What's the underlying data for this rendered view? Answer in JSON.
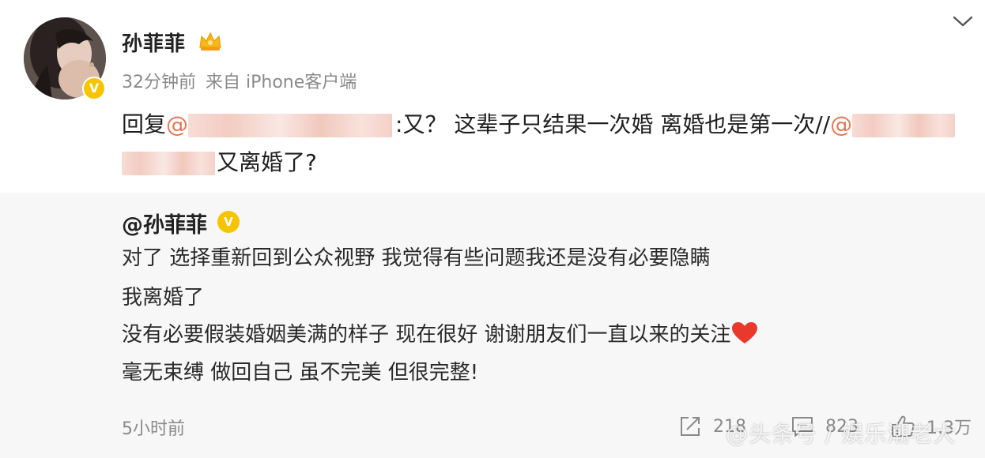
{
  "post": {
    "username": "孙菲菲",
    "time": "32分钟前",
    "source": "来自 iPhone客户端",
    "reply_prefix": "回复",
    "at_symbol": "@",
    "reply_text": ":又？ 这辈子只结果一次婚 离婚也是第一次//",
    "reply_tail": "又离婚了?"
  },
  "quoted": {
    "name": "@孙菲菲",
    "lines": [
      "对了 选择重新回到公众视野 我觉得有些问题我还是没有必要隐瞒",
      "我离婚了",
      "没有必要假装婚姻美满的样子 现在很好 谢谢朋友们一直以来的关注",
      "毫无束缚 做回自己 虽不完美 但很完整!"
    ],
    "time": "5小时前",
    "share_count": "218",
    "comment_count": "823",
    "like_count": "1.3万"
  },
  "watermark": "@头条号 / 娱乐潮老大",
  "colors": {
    "mention": "#eb7350",
    "verified_badge": "#f7c400",
    "quote_background": "#f7f7f7",
    "meta_gray": "#8a8a8a",
    "heart": "#e8392c"
  },
  "icons": [
    "chevron-down-icon",
    "crown-icon",
    "verified-icon",
    "heart-icon",
    "share-icon",
    "comment-icon",
    "like-icon"
  ]
}
